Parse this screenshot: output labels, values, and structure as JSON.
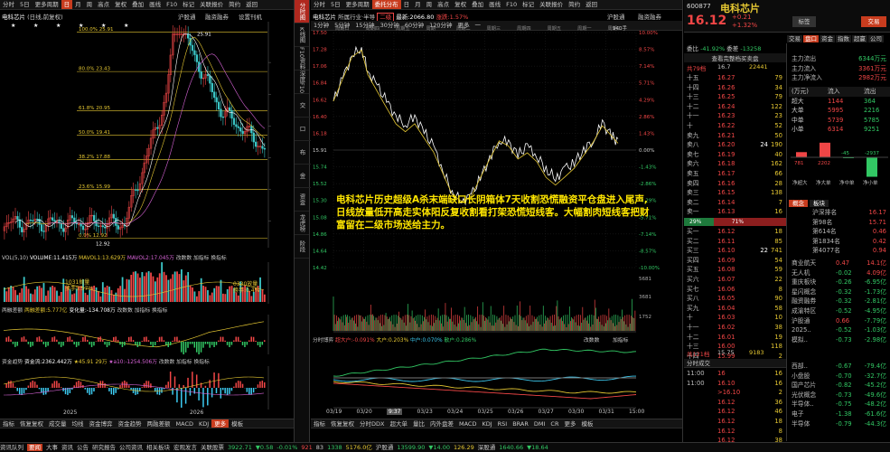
{
  "colors": {
    "bg": "#000000",
    "up": "#f04646",
    "down": "#32c864",
    "yellow": "#e6c832",
    "cyan": "#3ccaf0",
    "accent": "#c83c1e"
  },
  "left": {
    "toolbar": [
      "分时",
      "5日",
      "更多周期",
      "日",
      "月",
      "周",
      "高点",
      "复权",
      "叠加",
      "画线",
      "F10",
      "标记",
      "关联报价",
      "简约",
      "返回"
    ],
    "toolbar_active": 3,
    "title": "电科芯片",
    "title_tags": "(日线,前复权)",
    "label_hj": "沪股通",
    "label_rz": "融资融券",
    "label_sz": "设置刊机",
    "fib": [
      "100.0% 25.91",
      "80.0% 23.43",
      "61.8% 20.95",
      "50.0% 19.41",
      "38.2% 17.88",
      "23.6% 15.99",
      "0.0% 12.92"
    ],
    "high_mark": "25.91",
    "low_mark": "12.92",
    "x_axis": [
      "2025",
      "2026"
    ],
    "vol_header": {
      "a": "VOL(5,10)",
      "b": "VOLUME:11.415万",
      "c": "MAVOL1:13.629万",
      "d": "MAVOL2:17.045万",
      "e": "改数数",
      "f": "加指标",
      "g": "换指标"
    },
    "vol_ann1": "1031抛量",
    "vol_ann1b": "换手5.57%",
    "vol_ann2": "0330放量",
    "vol_ann2b": "换手:0.4%",
    "mid_header": {
      "a": "两融差额",
      "b": "两融差额:5.777亿",
      "c": "变化量:-134.708万",
      "d": "改数数",
      "e": "加指标",
      "f": "换指标"
    },
    "fund_header": {
      "a": "资金趋势",
      "b": "资金流:2362.442万",
      "c": "★45.91 29万",
      "d": "★a10:-1254.506万",
      "e": "改数数",
      "f": "加指标",
      "g": "换指标"
    },
    "bottom_tabs": [
      "指标",
      "恢复复权",
      "成交量",
      "均线",
      "资金博弈",
      "资金趋势",
      "两融差额",
      "MACD",
      "KDJ",
      "更多",
      "模板"
    ],
    "bottom_active": 9
  },
  "mid": {
    "toolbar": [
      "分时",
      "5日",
      "更多周期",
      "日",
      "月",
      "周",
      "高点",
      "复权",
      "叠加",
      "画线",
      "F10",
      "标记",
      "关联报价",
      "简约",
      "返回"
    ],
    "toolbar2": [
      "1分钟",
      "5分钟",
      "15分钟",
      "30分钟",
      "60分钟",
      "120分钟",
      "更多",
      "一"
    ],
    "tabs_active": "委托分布",
    "title": "电科芯片",
    "sub": "所属行业·半导",
    "tag": "二级",
    "metric": "最新:2066.80",
    "pct": "涨跌:1.57%",
    "right_label": "沪股通",
    "right_label2": "融资融券",
    "price_axis": [
      "17.50",
      "17.28",
      "17.06",
      "16.84",
      "16.62",
      "16.40",
      "16.18",
      "15.91",
      "15.74",
      "15.52",
      "15.30",
      "15.08",
      "14.86",
      "14.64",
      "14.42"
    ],
    "pct_axis": [
      "10.00%",
      "8.57%",
      "7.14%",
      "5.71%",
      "4.29%",
      "2.86%",
      "1.43%",
      "0.00%",
      "-1.43%",
      "-2.86%",
      "-4.29%",
      "-5.71%",
      "-7.14%",
      "-8.57%",
      "-10.00%"
    ],
    "date_top": [
      "周期日",
      "周期四",
      "周期五",
      "周期一",
      "周期二",
      "周期三",
      "周期四",
      "周期五",
      "周期一",
      "周期二"
    ],
    "corner": "940手",
    "overlay_text": "电科芯片历史超级A杀末端缺口长阴箱体7天收割恐慌融资平仓盘进入尾声,日线放量低开高走实体阳反复收割看打架恐慌短线客。大幅割肉短线客把财富留在二级市场送给主力。",
    "vol_axis": [
      "5681",
      "3681",
      "1752"
    ],
    "fund_header": {
      "a": "分时博弈",
      "b": "超大户:-0.091%",
      "c": "大户:0.203%",
      "d": "中户:0.070%",
      "e": "散户:0.286%",
      "f": "改数数",
      "g": "加指标"
    },
    "x_axis": [
      "03/19",
      "03/20",
      "9:37",
      "03/23",
      "03/24",
      "03/25",
      "03/26",
      "03/27",
      "03/30",
      "03/31",
      "15:00"
    ],
    "bottom_tabs": [
      "指标",
      "恢复复权",
      "分时DDX",
      "超大单",
      "量比",
      "内外盘差",
      "MACD",
      "KDJ",
      "RSI",
      "BRAR",
      "DMI",
      "CR",
      "更多",
      "模板"
    ]
  },
  "side_tabs": [
    "分时图",
    "K线图",
    "F10资料",
    "深度F10",
    "分时成交",
    "分时盘口",
    "委托分布",
    "深度资金",
    "资金",
    "龙虎榜",
    "阶段"
  ],
  "right": {
    "code": "600877",
    "name": "电科芯片",
    "price": "16.12",
    "chg": "+0.21",
    "pct": "+1.32%",
    "btn_tag": "标签",
    "btn_trade": "交易",
    "tabs": [
      "交易",
      "盘口",
      "资金",
      "指数",
      "超赢",
      "公司"
    ],
    "ratio_label": "委比",
    "ratio": "-41.92%",
    "diff_label": "委差",
    "diff": "-13258",
    "detail_label": "查看完整档买卖盘",
    "total_sell_label": "共79档",
    "total_sell_price": "16.7",
    "total_sell_vol": "22441",
    "total_buy_label": "共121档",
    "total_buy_price": "15.75",
    "total_buy_vol": "9183",
    "sell": [
      [
        "十五",
        "16.27",
        "79"
      ],
      [
        "十四",
        "16.26",
        "34"
      ],
      [
        "十三",
        "16.25",
        "79"
      ],
      [
        "十二",
        "16.24",
        "122"
      ],
      [
        "十一",
        "16.23",
        "23"
      ],
      [
        "十",
        "16.22",
        "52"
      ],
      [
        "卖九",
        "16.21",
        "50"
      ],
      [
        "卖八",
        "16.20",
        "190"
      ],
      [
        "卖七",
        "16.19",
        "40"
      ],
      [
        "卖六",
        "16.18",
        "162"
      ],
      [
        "卖五",
        "16.17",
        "66"
      ],
      [
        "卖四",
        "16.16",
        "28"
      ],
      [
        "卖三",
        "16.15",
        "138"
      ],
      [
        "卖二",
        "16.14",
        "7"
      ],
      [
        "卖一",
        "16.13",
        "16"
      ]
    ],
    "buy": [
      [
        "买一",
        "16.12",
        "18"
      ],
      [
        "买二",
        "16.11",
        "85"
      ],
      [
        "买三",
        "16.10",
        "741"
      ],
      [
        "买四",
        "16.09",
        "54"
      ],
      [
        "买五",
        "16.08",
        "59"
      ],
      [
        "买六",
        "16.07",
        "22"
      ],
      [
        "买七",
        "16.06",
        "8"
      ],
      [
        "买八",
        "16.05",
        "90"
      ],
      [
        "买九",
        "16.04",
        "58"
      ],
      [
        "十",
        "16.03",
        "10"
      ],
      [
        "十一",
        "16.02",
        "38"
      ],
      [
        "十二",
        "16.01",
        "19"
      ],
      [
        "十三",
        "16.00",
        "118"
      ],
      [
        "十四",
        "15.99",
        "2"
      ],
      [
        "十五",
        "15.98",
        "3"
      ]
    ],
    "sell_mark": "24",
    "buy_mark": "22",
    "pct_bar": {
      "left": "29%",
      "right": "71%"
    },
    "flow": [
      [
        "主力流出",
        "6344万元"
      ],
      [
        "主力流入",
        "3361万元"
      ],
      [
        "主力净流入",
        "2982万元"
      ]
    ],
    "flow_tabs": [
      "(万元)",
      "流入",
      "流出"
    ],
    "flow_table": [
      [
        "超大",
        "1144",
        "364"
      ],
      [
        "大单",
        "5995",
        "2216"
      ],
      [
        "中单",
        "5739",
        "5785"
      ],
      [
        "小单",
        "6314",
        "9251"
      ]
    ],
    "bars_vals": [
      "781",
      "2202",
      "-45",
      "-2937"
    ],
    "bars_labels": [
      "净超大",
      "净大单",
      "净中单",
      "净小单"
    ],
    "rank": [
      [
        "沪深排名",
        "16.17"
      ],
      [
        "第98名",
        "15.71"
      ],
      [
        "第614名",
        "0.46"
      ],
      [
        "第1834名",
        "0.42"
      ],
      [
        "第4077名",
        "0.94"
      ]
    ],
    "rank_tabs": [
      "概念",
      "板块"
    ],
    "sectors": [
      [
        "商业航天",
        "0.47",
        "14.1亿"
      ],
      [
        "无人机",
        "-0.02",
        "4.09亿"
      ],
      [
        "重庆板块",
        "-0.26",
        "-6.95亿"
      ],
      [
        "星闪概念",
        "-0.32",
        "-1.73亿"
      ],
      [
        "融资融券",
        "-0.32",
        "-2.81亿"
      ],
      [
        "成渝特区",
        "-0.52",
        "-4.95亿"
      ],
      [
        "沪股通",
        "0.66",
        "-7.79亿"
      ],
      [
        "2025..",
        "-0.52",
        "-1.03亿"
      ],
      [
        "模拟..",
        "-0.73",
        "-2.98亿"
      ]
    ],
    "sector_right": [
      "电科芯片",
      "主力净流入",
      "16.12"
    ],
    "trades_header": "分时成交",
    "trades": [
      [
        "11:00",
        "16",
        "16"
      ],
      [
        "11:00",
        "16.10",
        "16"
      ],
      [
        "",
        ">16.10",
        "2"
      ],
      [
        "",
        "16.12",
        "36"
      ],
      [
        "",
        "16.12",
        "46"
      ],
      [
        "",
        "16.12",
        "18"
      ],
      [
        "",
        "16.12",
        "8"
      ],
      [
        "",
        "16.12",
        "38"
      ],
      [
        "",
        "16.12",
        "20"
      ]
    ],
    "trades_hd2": "盘口",
    "industry": [
      [
        "西部..",
        "-0.67",
        "-79.4亿"
      ],
      [
        "小盘股",
        "-0.70",
        "-32.7亿"
      ],
      [
        "国产芯片",
        "-0.82",
        "-45.2亿"
      ],
      [
        "光伏概念",
        "-0.73",
        "-49.6亿"
      ],
      [
        "半导体..",
        "-0.75",
        "-48.2亿"
      ],
      [
        "电子",
        "-1.38",
        "-61.6亿"
      ],
      [
        "半导体",
        "-0.79",
        "-44.3亿"
      ]
    ]
  },
  "statusbar": [
    "资讯队列",
    "要闻",
    "大事",
    "资讯",
    "公告",
    "研究报告",
    "公司资讯",
    "相关板块",
    "宏观发言",
    "关联股票"
  ],
  "status_index": {
    "a": "3922.71",
    "b": "▼0.58",
    "c": "-0.01%",
    "d": "921",
    "e": "83",
    "f": "1338",
    "g": "5176.0亿",
    "h": "沪股通",
    "i": "13599.90",
    "j": "▼14.00",
    "k": "126.29",
    "l": "深股通",
    "m": "1640.66",
    "n": "▼18.64"
  }
}
